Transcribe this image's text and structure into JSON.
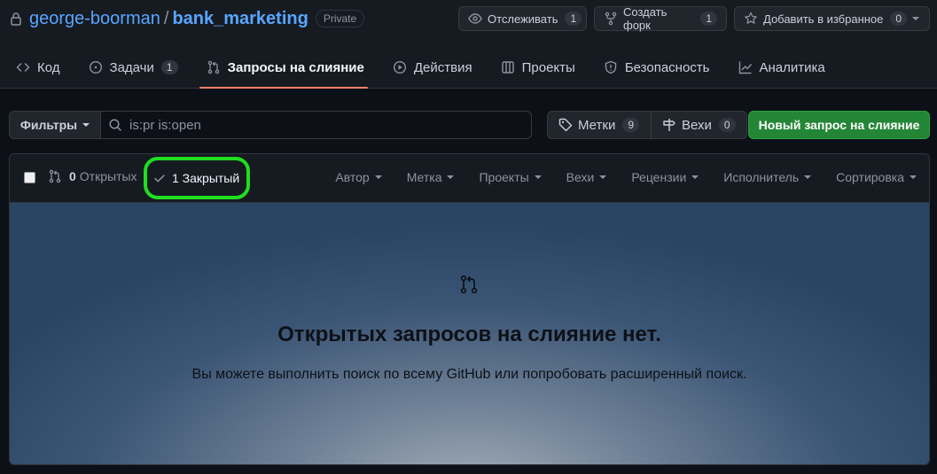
{
  "repo": {
    "owner": "george-boorman",
    "separator": "/",
    "name": "bank_marketing",
    "visibility": "Private"
  },
  "actions": {
    "watch": {
      "label": "Отслеживать",
      "count": "1"
    },
    "fork": {
      "label": "Создать форк",
      "count": "1"
    },
    "star": {
      "label": "Добавить в избранное",
      "count": "0"
    }
  },
  "tabs": [
    {
      "label": "Код",
      "icon": "code-icon"
    },
    {
      "label": "Задачи",
      "icon": "issue-icon",
      "count": "1"
    },
    {
      "label": "Запросы на слияние",
      "icon": "pull-request-icon",
      "active": true
    },
    {
      "label": "Действия",
      "icon": "play-icon"
    },
    {
      "label": "Проекты",
      "icon": "table-icon"
    },
    {
      "label": "Безопасность",
      "icon": "shield-icon"
    },
    {
      "label": "Аналитика",
      "icon": "graph-icon"
    }
  ],
  "filters": {
    "label": "Фильтры",
    "search_value": "is:pr is:open",
    "labels": {
      "label": "Метки",
      "count": "9"
    },
    "milestones": {
      "label": "Вехи",
      "count": "0"
    },
    "new_pr": "Новый запрос на слияние"
  },
  "list": {
    "open_count": "0",
    "open_label": "Открытых",
    "closed_label": "1 Закрытый",
    "sort_menus": [
      "Автор",
      "Метка",
      "Проекты",
      "Вехи",
      "Рецензии",
      "Исполнитель",
      "Сортировка"
    ]
  },
  "blankslate": {
    "title": "Открытых запросов на слияние нет.",
    "description": "Вы можете выполнить поиск по всему GitHub или попробовать расширенный поиск."
  },
  "colors": {
    "accent_tab_underline": "#f78166",
    "primary_button": "#238636",
    "highlight_ring": "#1fdf1f",
    "link": "#58a6ff"
  }
}
